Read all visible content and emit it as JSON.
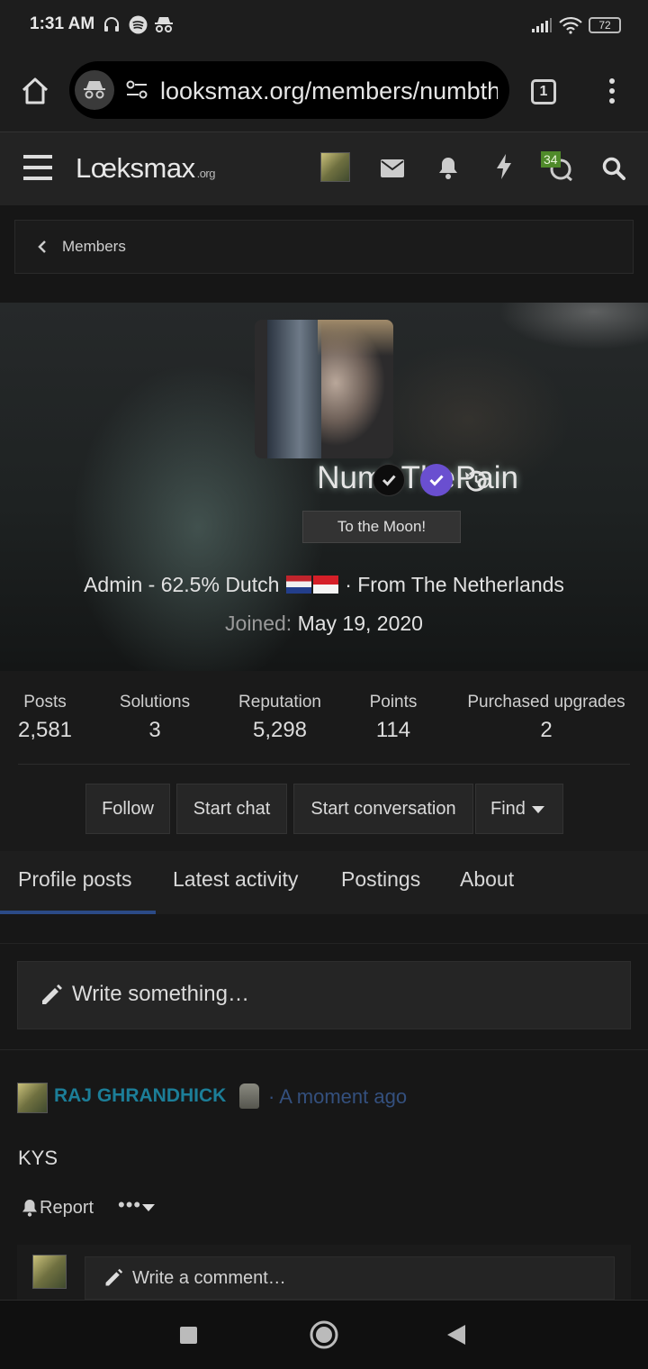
{
  "status_bar": {
    "time": "1:31 AM",
    "battery": "72",
    "icons": [
      "headphones-icon",
      "spotify-icon",
      "incognito-icon",
      "signal-icon",
      "wifi-icon",
      "battery-icon"
    ]
  },
  "browser": {
    "url": "looksmax.org/members/numbthepain",
    "tab_count": "1"
  },
  "site_header": {
    "logo_main": "Lœksmax",
    "logo_suffix": ".org",
    "conversations_badge": "34"
  },
  "breadcrumb": {
    "label": "Members"
  },
  "profile": {
    "username": "NumbThePain",
    "user_title": "To the Moon!",
    "blurb_prefix": "Admin - 62.5% Dutch",
    "blurb_suffix": "· From The Netherlands",
    "joined_label": "Joined:",
    "joined_date": "May 19, 2020"
  },
  "stats": [
    {
      "label": "Posts",
      "value": "2,581"
    },
    {
      "label": "Solutions",
      "value": "3"
    },
    {
      "label": "Reputation",
      "value": "5,298"
    },
    {
      "label": "Points",
      "value": "114"
    },
    {
      "label": "Purchased upgrades",
      "value": "2"
    }
  ],
  "actions": {
    "follow": "Follow",
    "start_chat": "Start chat",
    "start_conversation": "Start conversation",
    "find": "Find"
  },
  "tabs": [
    {
      "label": "Profile posts",
      "active": true
    },
    {
      "label": "Latest activity",
      "active": false
    },
    {
      "label": "Postings",
      "active": false
    },
    {
      "label": "About",
      "active": false
    }
  ],
  "composer": {
    "placeholder": "Write something…"
  },
  "post": {
    "author": "RAJ GHRANDHICK",
    "time": "· A moment ago",
    "text": "KYS",
    "report_label": "Report",
    "more_label": "•••",
    "comment_placeholder": "Write a comment…"
  },
  "colors": {
    "accent_blue": "#2b4a86",
    "username_teal": "#1c7e98",
    "badge_purple": "#6a4fd0",
    "badge_green": "#4f8a2a"
  }
}
